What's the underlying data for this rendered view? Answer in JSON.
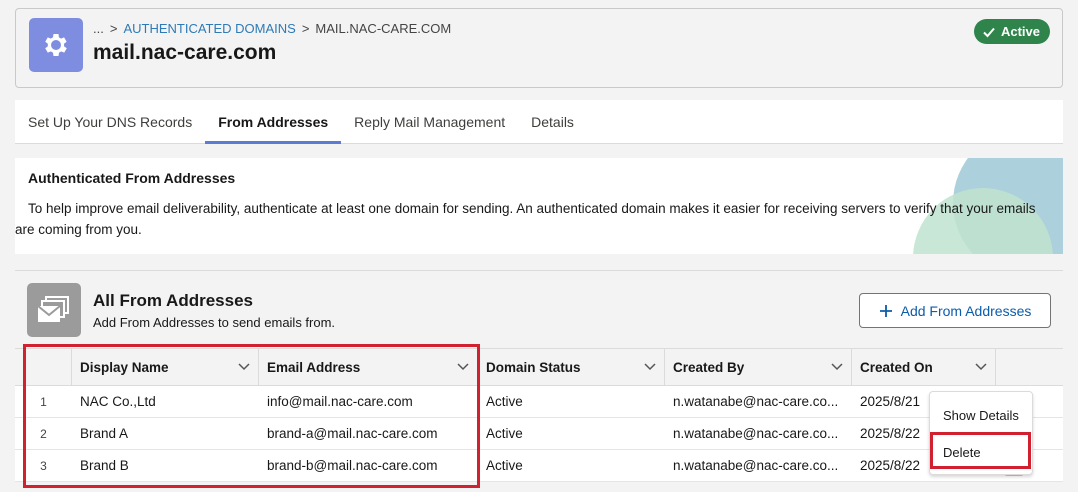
{
  "header": {
    "breadcrumb_ellipsis": "...",
    "breadcrumb_sep": ">",
    "breadcrumb_parent": "AUTHENTICATED DOMAINS",
    "breadcrumb_current": "MAIL.NAC-CARE.COM",
    "title": "mail.nac-care.com",
    "status": "Active",
    "icon": "gear-icon"
  },
  "tabs": [
    {
      "label": "Set Up Your DNS Records"
    },
    {
      "label": "From Addresses"
    },
    {
      "label": "Reply Mail Management"
    },
    {
      "label": "Details"
    }
  ],
  "banner": {
    "title": "Authenticated From Addresses",
    "text": "To help improve email deliverability, authenticate at least one domain for sending. An authenticated domain makes it easier for receiving servers to verify that your emails are coming from you."
  },
  "list": {
    "title": "All From Addresses",
    "subtitle": "Add From Addresses to send emails from.",
    "add_button": "Add From Addresses",
    "icon": "stacked-envelope-icon"
  },
  "table": {
    "columns": [
      {
        "label": "Display Name"
      },
      {
        "label": "Email Address"
      },
      {
        "label": "Domain Status"
      },
      {
        "label": "Created By"
      },
      {
        "label": "Created On"
      }
    ],
    "rows": [
      {
        "num": "1",
        "display_name": "NAC Co.,Ltd",
        "email": "info@mail.nac-care.com",
        "status": "Active",
        "created_by": "n.watanabe@nac-care.co...",
        "created_on": "2025/8/21"
      },
      {
        "num": "2",
        "display_name": "Brand A",
        "email": "brand-a@mail.nac-care.com",
        "status": "Active",
        "created_by": "n.watanabe@nac-care.co...",
        "created_on": "2025/8/22"
      },
      {
        "num": "3",
        "display_name": "Brand B",
        "email": "brand-b@mail.nac-care.com",
        "status": "Active",
        "created_by": "n.watanabe@nac-care.co...",
        "created_on": "2025/8/22"
      }
    ]
  },
  "menu": {
    "show_details": "Show Details",
    "delete": "Delete"
  },
  "colors": {
    "accent": "#0b5cab",
    "active_green": "#2e844a",
    "highlight_red": "#d1202f"
  }
}
